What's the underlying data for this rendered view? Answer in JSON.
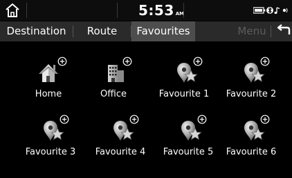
{
  "status": {
    "time": "5:53",
    "ampm": "AM"
  },
  "tabs": [
    {
      "label": "Destination",
      "active": false,
      "enabled": true
    },
    {
      "label": "Route",
      "active": false,
      "enabled": true
    },
    {
      "label": "Favourites",
      "active": true,
      "enabled": true
    },
    {
      "label": "Menu",
      "active": false,
      "enabled": false
    }
  ],
  "icons": {
    "home_button": "home-icon",
    "back_button": "return-arrow-icon"
  },
  "favourites": [
    {
      "label": "Home",
      "icon": "house-icon"
    },
    {
      "label": "Office",
      "icon": "office-building-icon"
    },
    {
      "label": "Favourite 1",
      "icon": "map-pin-star-icon"
    },
    {
      "label": "Favourite 2",
      "icon": "map-pin-star-icon"
    },
    {
      "label": "Favourite 3",
      "icon": "map-pin-star-icon"
    },
    {
      "label": "Favourite 4",
      "icon": "map-pin-star-icon"
    },
    {
      "label": "Favourite 5",
      "icon": "map-pin-star-icon"
    },
    {
      "label": "Favourite 6",
      "icon": "map-pin-star-icon"
    }
  ]
}
